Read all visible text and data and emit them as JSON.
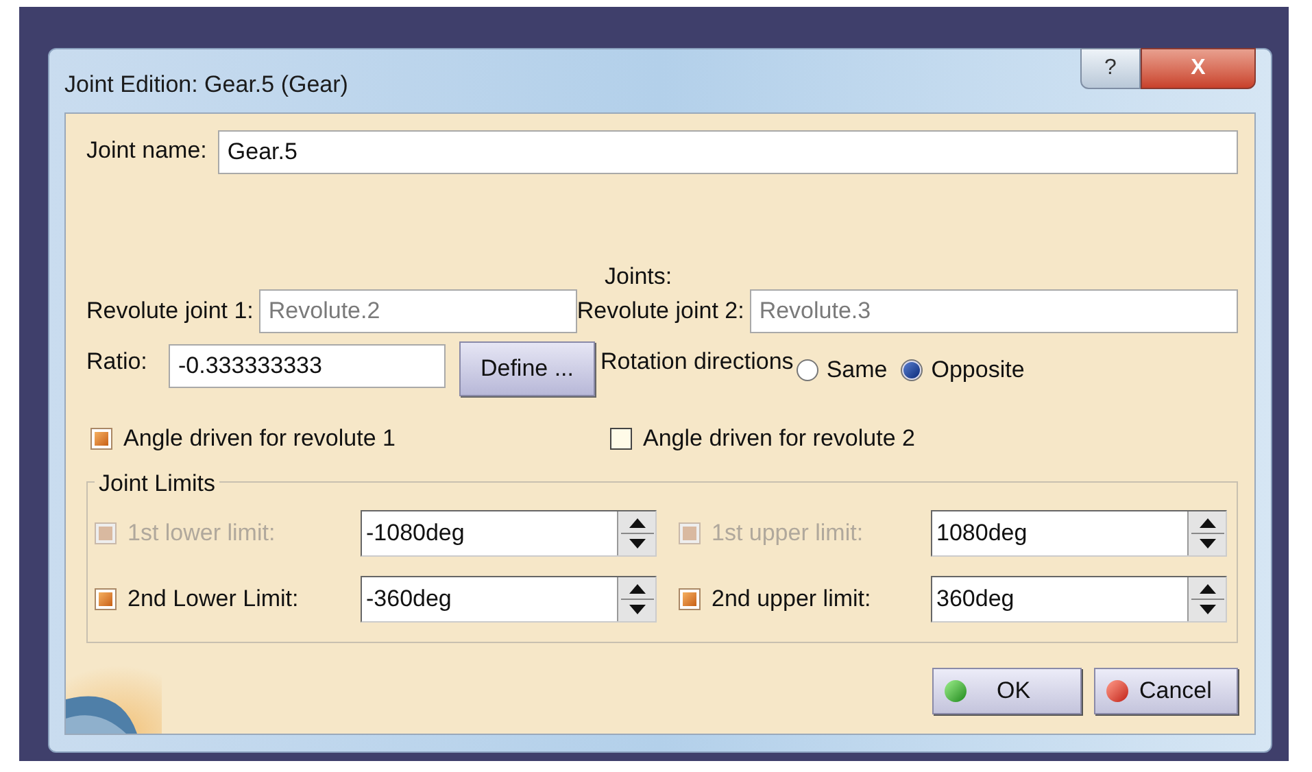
{
  "window": {
    "title": "Joint Edition: Gear.5 (Gear)",
    "title_buttons": [
      {
        "kind": "help",
        "label": "?"
      },
      {
        "kind": "close",
        "label": "X"
      }
    ]
  },
  "joint_name": {
    "label": "Joint name:",
    "value": "Gear.5"
  },
  "joints": {
    "label": "Joints:",
    "fields": [
      {
        "label": "Revolute joint 1:",
        "value": "Revolute.2",
        "disabled": true
      },
      {
        "label": "Revolute joint 2:",
        "value": "Revolute.3",
        "disabled": true
      }
    ]
  },
  "ratio": {
    "label": "Ratio:",
    "value": "-0.333333333",
    "button": "Define ..."
  },
  "rotation_directions": {
    "label": "Rotation directions",
    "options": [
      {
        "label": "Same",
        "selected": false
      },
      {
        "label": "Opposite",
        "selected": true
      }
    ]
  },
  "angle_driven": [
    {
      "label": "Angle driven for revolute 1",
      "checked": true
    },
    {
      "label": "Angle driven for revolute 2",
      "checked": false
    }
  ],
  "joint_limits": {
    "title": "Joint Limits",
    "limits": [
      {
        "label": "1st lower limit:",
        "checked": true,
        "disabled": true,
        "value": "-1080deg"
      },
      {
        "label": "1st upper limit:",
        "checked": true,
        "disabled": true,
        "value": "1080deg"
      },
      {
        "label": "2nd Lower Limit:",
        "checked": true,
        "disabled": false,
        "value": "-360deg"
      },
      {
        "label": "2nd upper limit:",
        "checked": true,
        "disabled": false,
        "value": "360deg"
      }
    ]
  },
  "buttons": [
    {
      "kind": "ok",
      "label": "OK"
    },
    {
      "kind": "cancel",
      "label": "Cancel"
    }
  ]
}
